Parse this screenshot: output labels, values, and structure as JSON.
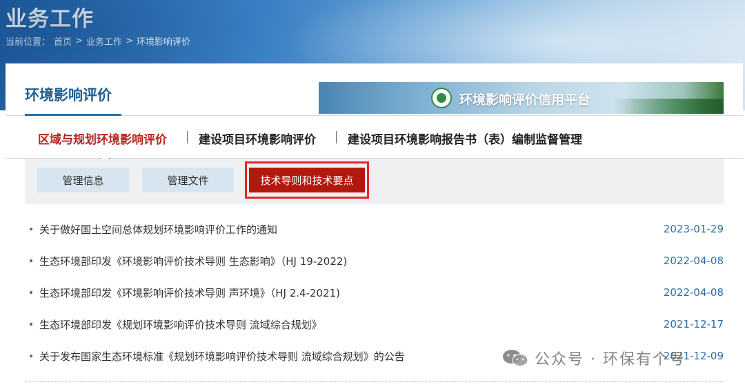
{
  "header": {
    "title": "业务工作",
    "breadcrumb": {
      "prefix": "当前位置：",
      "items": [
        "首页",
        "业务工作",
        "环境影响评价"
      ],
      "separator": ">"
    }
  },
  "section": {
    "title": "环境影响评价",
    "banner_text": "环境影响评价信用平台",
    "banner_icon": "eco-logo-icon"
  },
  "tabs": [
    {
      "label": "区域与规划环境影响评价",
      "active": true
    },
    {
      "label": "建设项目环境影响评价",
      "active": false
    },
    {
      "label": "建设项目环境影响报告书（表）编制监督管理",
      "active": false
    }
  ],
  "subtabs": [
    {
      "label": "管理信息",
      "active": false
    },
    {
      "label": "管理文件",
      "active": false
    },
    {
      "label": "技术导则和技术要点",
      "active": true
    }
  ],
  "news": [
    {
      "title": "关于做好国土空间总体规划环境影响评价工作的通知",
      "date": "2023-01-29"
    },
    {
      "title": "生态环境部印发《环境影响评价技术导则 生态影响》（HJ 19-2022)",
      "date": "2022-04-08"
    },
    {
      "title": "生态环境部印发《环境影响评价技术导则 声环境》（HJ 2.4-2021)",
      "date": "2022-04-08"
    },
    {
      "title": "生态环境部印发《规划环境影响评价技术导则 流域综合规划》",
      "date": "2021-12-17"
    },
    {
      "title": "关于发布国家生态环境标准《规划环境影响评价技术导则 流域综合规划》的公告",
      "date": "2021-12-09"
    }
  ],
  "watermark": {
    "text": "公众号 · 环保有个号",
    "icon": "wechat-icon"
  },
  "colors": {
    "accent_red": "#b3261e",
    "active_subtab": "#b3180f",
    "highlight_frame": "#e8232a",
    "link_blue": "#2e6ea6",
    "title_blue": "#1f5f8f",
    "subtab_bg": "#d6e5f0"
  }
}
